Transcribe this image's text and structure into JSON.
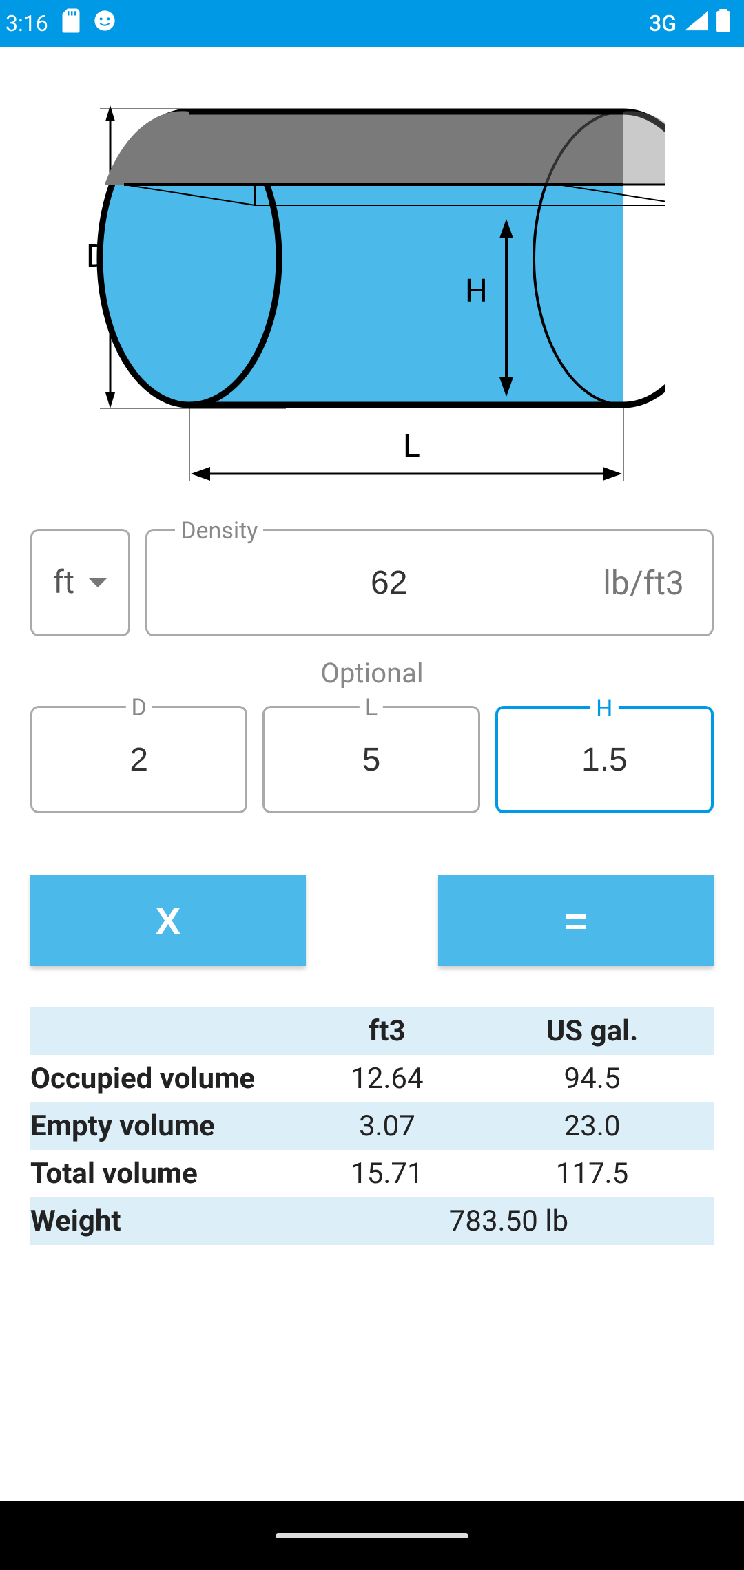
{
  "statusBar": {
    "time": "3:16",
    "network": "3G"
  },
  "diagram": {
    "label_D": "D",
    "label_H": "H",
    "label_L": "L"
  },
  "inputs": {
    "unit_selected": "ft",
    "density_label": "Density",
    "density_value": "62",
    "density_unit": "lb/ft3",
    "optional_label": "Optional",
    "dims": {
      "D": {
        "label": "D",
        "value": "2"
      },
      "L": {
        "label": "L",
        "value": "5"
      },
      "H": {
        "label": "H",
        "value": "1.5"
      }
    }
  },
  "buttons": {
    "clear": "X",
    "equals": "="
  },
  "results": {
    "headers": {
      "col1": "ft3",
      "col2": "US gal."
    },
    "rows": {
      "occupied": {
        "label": "Occupied volume",
        "ft3": "12.64",
        "gal": "94.5"
      },
      "empty": {
        "label": "Empty volume",
        "ft3": "3.07",
        "gal": "23.0"
      },
      "total": {
        "label": "Total volume",
        "ft3": "15.71",
        "gal": "117.5"
      },
      "weight": {
        "label": "Weight",
        "value": "783.50 lb"
      }
    }
  }
}
